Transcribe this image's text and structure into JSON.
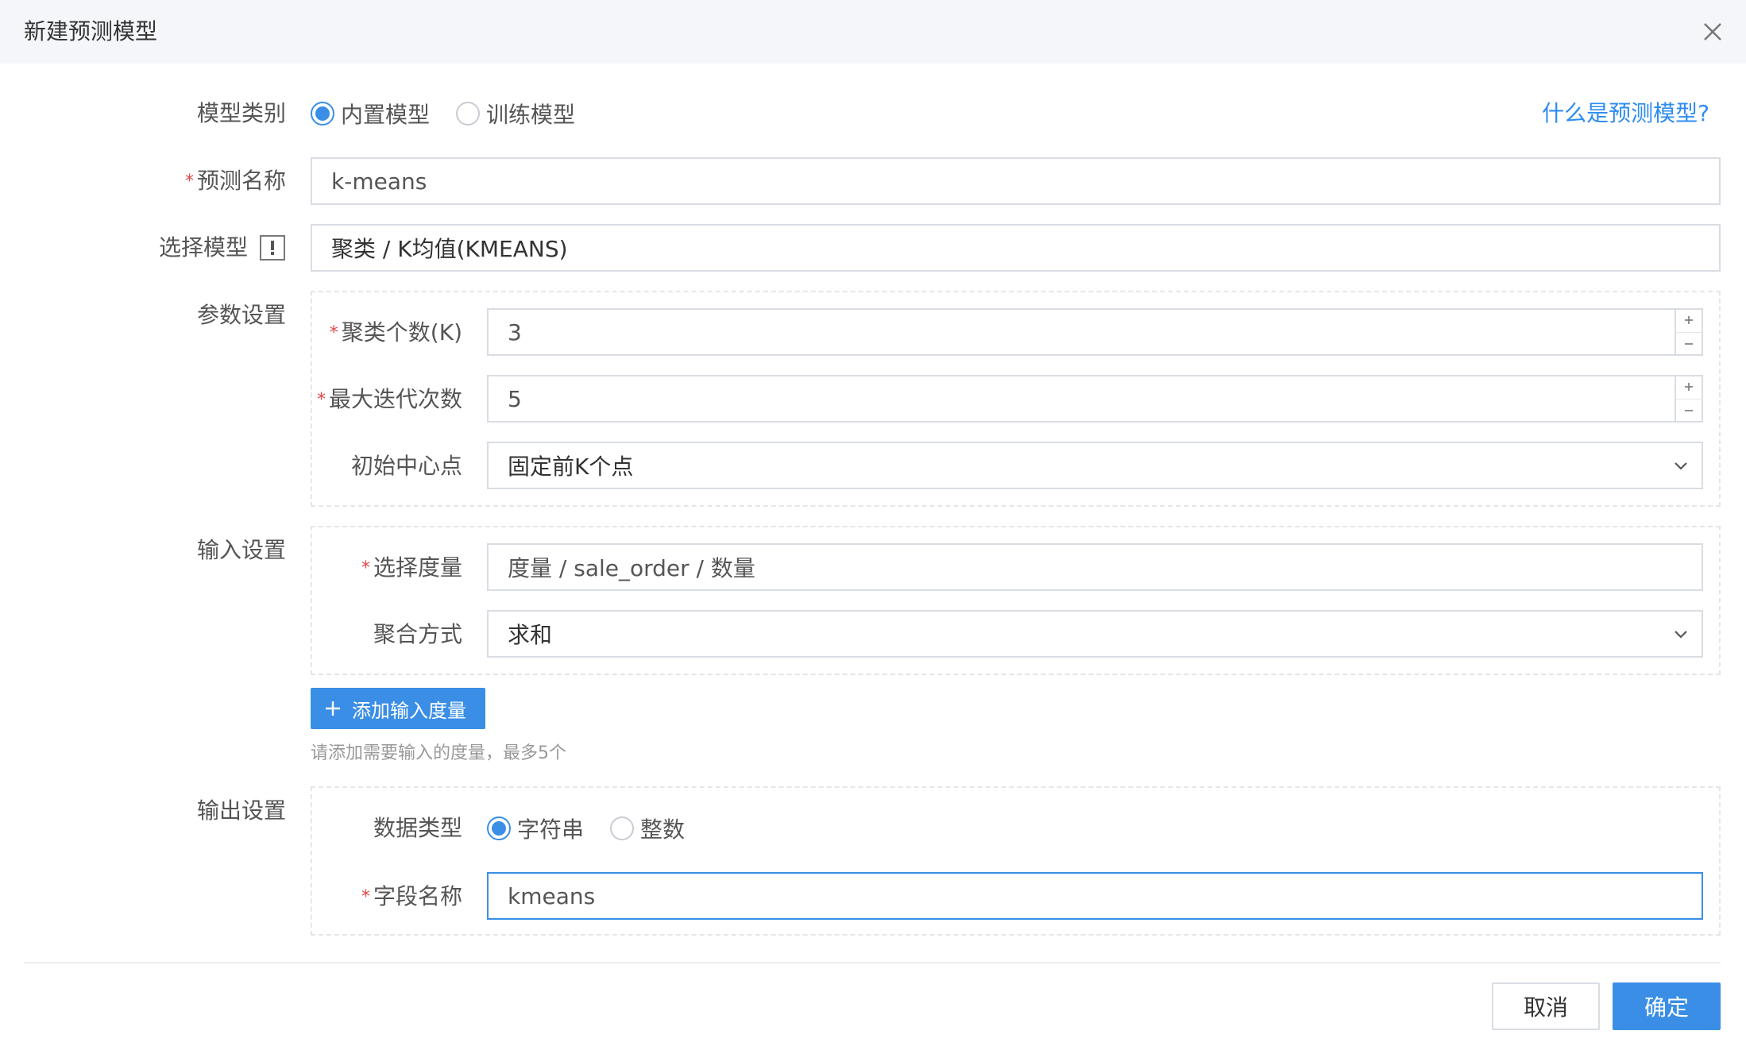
{
  "dialog": {
    "title": "新建预测模型",
    "help_link": "什么是预测模型?"
  },
  "model_type": {
    "label": "模型类别",
    "options": [
      "内置模型",
      "训练模型"
    ],
    "selected": "内置模型"
  },
  "prediction_name": {
    "label": "预测名称",
    "required": true,
    "value": "k-means"
  },
  "select_model": {
    "label": "选择模型",
    "value": "聚类 / K均值(KMEANS)",
    "icon": "exclamation-icon"
  },
  "params": {
    "label": "参数设置",
    "cluster_count": {
      "label": "聚类个数(K)",
      "required": true,
      "value": "3"
    },
    "max_iterations": {
      "label": "最大迭代次数",
      "required": true,
      "value": "5"
    },
    "initial_centers": {
      "label": "初始中心点",
      "value": "固定前K个点"
    }
  },
  "input_settings": {
    "label": "输入设置",
    "measure": {
      "label": "选择度量",
      "required": true,
      "value": "度量 / sale_order / 数量"
    },
    "aggregation": {
      "label": "聚合方式",
      "value": "求和"
    },
    "add_button": "添加输入度量",
    "hint": "请添加需要输入的度量，最多5个"
  },
  "output_settings": {
    "label": "输出设置",
    "data_type": {
      "label": "数据类型",
      "options": [
        "字符串",
        "整数"
      ],
      "selected": "字符串"
    },
    "field_name": {
      "label": "字段名称",
      "required": true,
      "value": "kmeans"
    }
  },
  "footer": {
    "cancel": "取消",
    "ok": "确定"
  },
  "colors": {
    "primary": "#3a8ee6",
    "required_star": "#e64545",
    "header_bg": "#f4f6f9"
  }
}
